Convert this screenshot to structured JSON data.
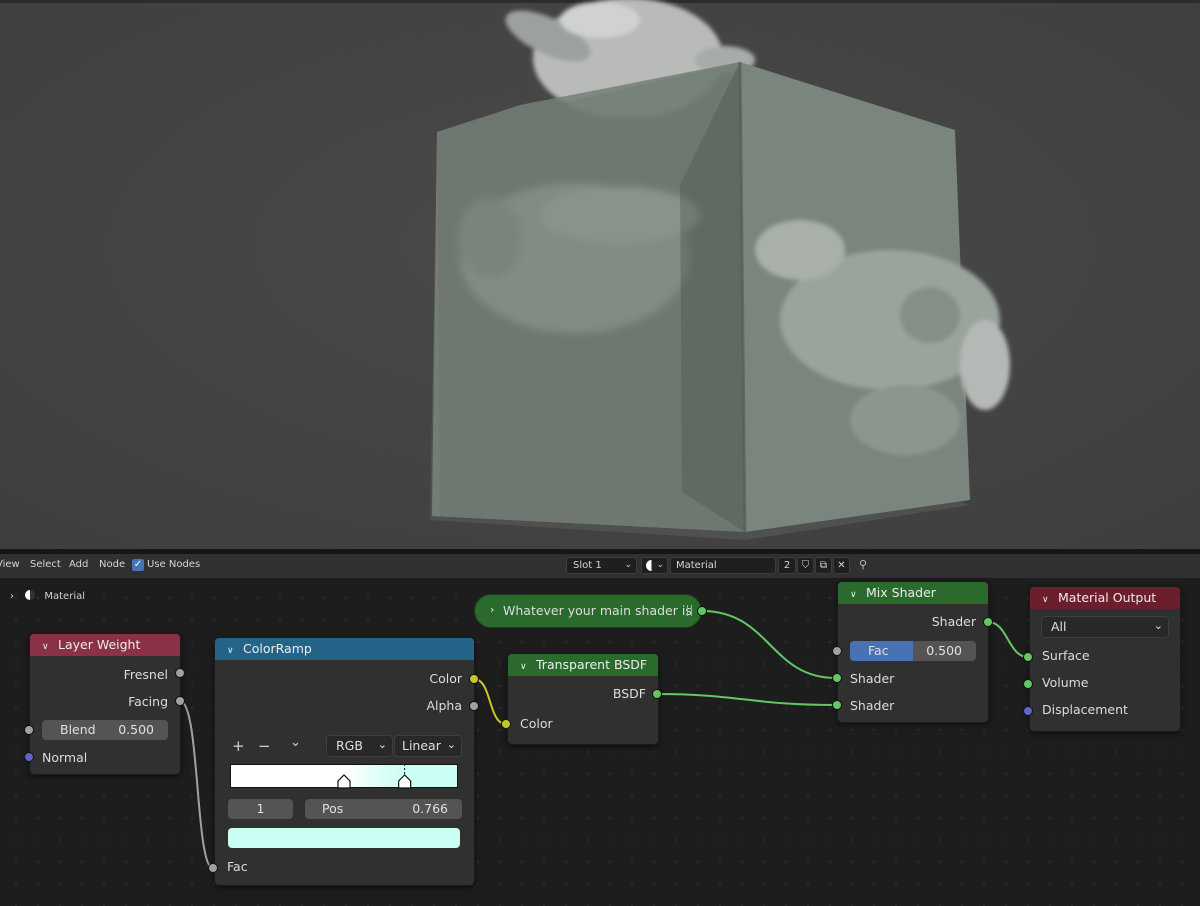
{
  "header": {
    "menu": [
      "View",
      "Select",
      "Add",
      "Node"
    ],
    "use_nodes_label": "Use Nodes",
    "slot": "Slot 1",
    "material_name": "Material",
    "user_count": "2"
  },
  "breadcrumb": {
    "material": "Material"
  },
  "frame": {
    "label": "Whatever your main shader is"
  },
  "layer_weight": {
    "title": "Layer Weight",
    "out_fresnel": "Fresnel",
    "out_facing": "Facing",
    "blend_label": "Blend",
    "blend_value": "0.500",
    "in_normal": "Normal"
  },
  "color_ramp": {
    "title": "ColorRamp",
    "out_color": "Color",
    "out_alpha": "Alpha",
    "add": "+",
    "remove": "−",
    "menu": "⌄",
    "color_mode": "RGB",
    "interpolation": "Linear",
    "active_index": "1",
    "pos_label": "Pos",
    "pos_value": "0.766",
    "stop_positions": [
      0.5,
      0.766
    ],
    "in_fac": "Fac"
  },
  "transparent_bsdf": {
    "title": "Transparent BSDF",
    "out_bsdf": "BSDF",
    "in_color": "Color"
  },
  "mix_shader": {
    "title": "Mix Shader",
    "out_shader": "Shader",
    "fac_label": "Fac",
    "fac_value": "0.500",
    "in_shader1": "Shader",
    "in_shader2": "Shader"
  },
  "material_output": {
    "title": "Material Output",
    "target": "All",
    "in_surface": "Surface",
    "in_volume": "Volume",
    "in_displacement": "Displacement"
  },
  "colors": {
    "input_header": "#8a3147",
    "converter_header": "#256489",
    "shader_header": "#2b6a2d",
    "output_header": "#6b1f2d",
    "shader_socket": "#63c763",
    "color_socket": "#c7c729",
    "float_socket": "#a1a1a1",
    "vector_socket": "#6363c7",
    "ramp_end_color": "#c9fff4",
    "selected_field": "#4772b3"
  }
}
